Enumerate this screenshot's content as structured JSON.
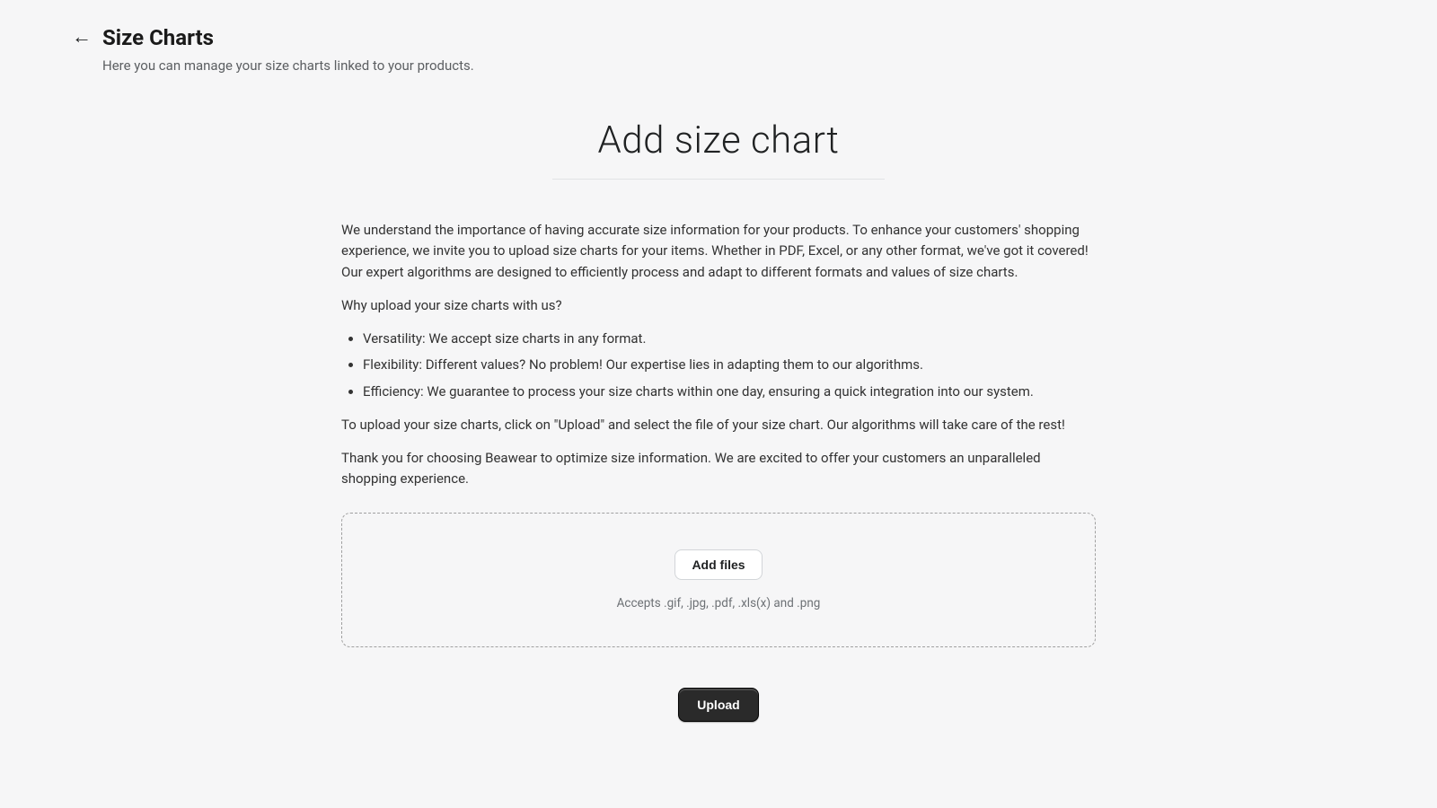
{
  "header": {
    "title": "Size Charts",
    "subtitle": "Here you can manage your size charts linked to your products."
  },
  "main": {
    "title": "Add size chart",
    "intro": "We understand the importance of having accurate size information for your products. To enhance your customers' shopping experience, we invite you to upload size charts for your items. Whether in PDF, Excel, or any other format, we've got it covered! Our expert algorithms are designed to efficiently process and adapt to different formats and values of size charts.",
    "why_heading": "Why upload your size charts with us?",
    "bullets": [
      "Versatility: We accept size charts in any format.",
      "Flexibility: Different values? No problem! Our expertise lies in adapting them to our algorithms.",
      "Efficiency: We guarantee to process your size charts within one day, ensuring a quick integration into our system."
    ],
    "howto": "To upload your size charts, click on \"Upload\" and select the file of your size chart. Our algorithms will take care of the rest!",
    "thanks": "Thank you for choosing Beawear to optimize size information. We are excited to offer your customers an unparalleled shopping experience.",
    "dropzone": {
      "add_files_label": "Add files",
      "hint": "Accepts .gif, .jpg, .pdf, .xls(x) and .png"
    },
    "upload_label": "Upload"
  }
}
